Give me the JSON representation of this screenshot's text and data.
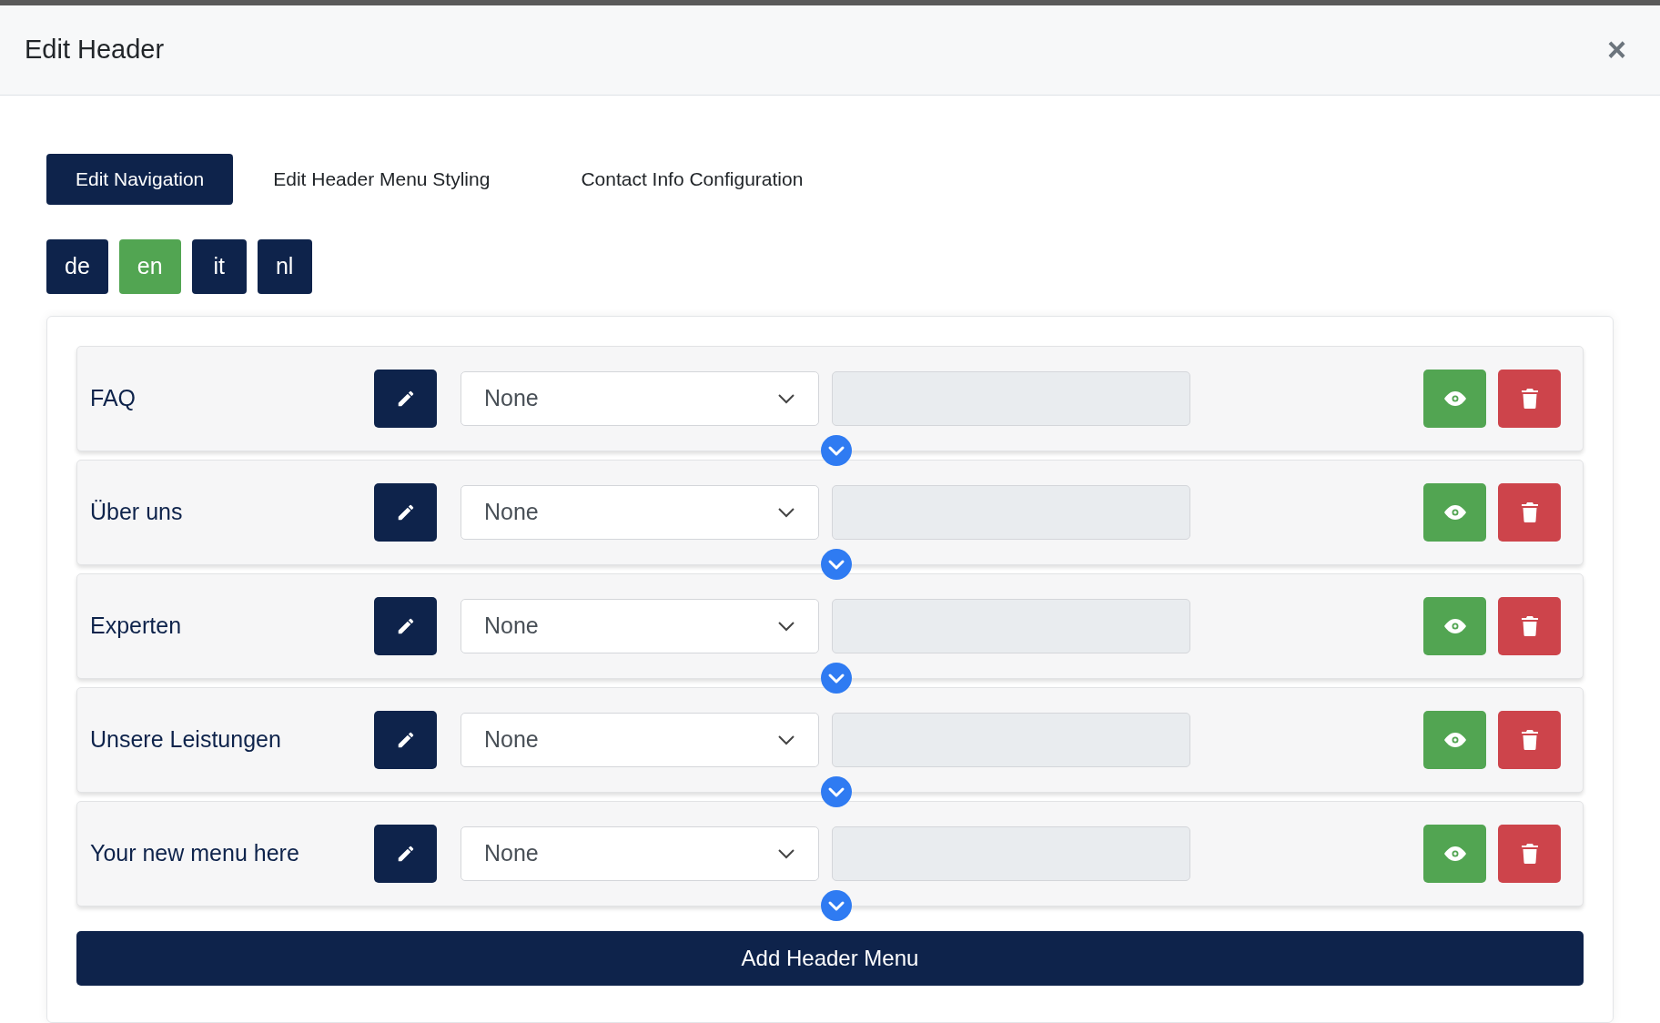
{
  "modal": {
    "title": "Edit Header",
    "close_label": "×"
  },
  "tabs": [
    {
      "label": "Edit Navigation",
      "selected": true
    },
    {
      "label": "Edit Header Menu Styling",
      "selected": false
    },
    {
      "label": "Contact Info Configuration",
      "selected": false
    }
  ],
  "languages": [
    {
      "label": "de",
      "selected": false
    },
    {
      "label": "en",
      "selected": true
    },
    {
      "label": "it",
      "selected": false
    },
    {
      "label": "nl",
      "selected": false
    }
  ],
  "menu_items": [
    {
      "name": "FAQ",
      "link_type": "None"
    },
    {
      "name": "Über uns",
      "link_type": "None"
    },
    {
      "name": "Experten",
      "link_type": "None"
    },
    {
      "name": "Unsere Leistungen",
      "link_type": "None"
    },
    {
      "name": "Your new menu here",
      "link_type": "None"
    }
  ],
  "add_button": "Add Header Menu"
}
